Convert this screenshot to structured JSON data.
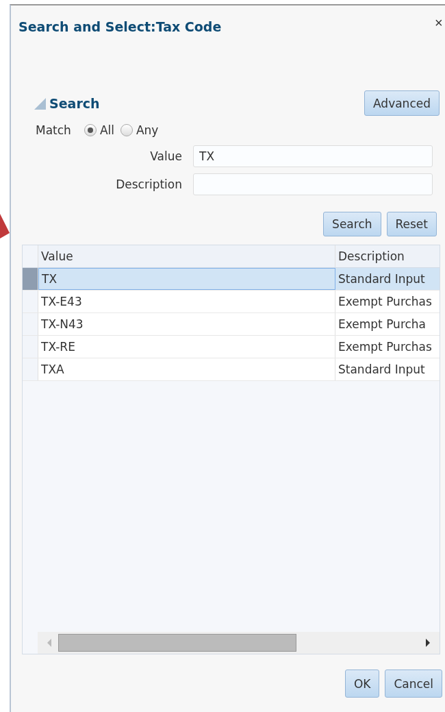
{
  "dialog": {
    "title": "Search and Select:Tax Code",
    "close": "×"
  },
  "search": {
    "heading": "Search",
    "advanced_button": "Advanced",
    "match_label": "Match",
    "match_options": [
      {
        "label": "All",
        "selected": true
      },
      {
        "label": "Any",
        "selected": false
      }
    ],
    "fields": [
      {
        "label": "Value",
        "value": "TX"
      },
      {
        "label": "Description"
      }
    ],
    "buttons": [
      "Search",
      "Reset"
    ]
  },
  "table": {
    "columns": [
      "Value",
      "Description"
    ],
    "rows": [
      {
        "cells": [
          "TX",
          "Standard Input"
        ],
        "selected": true
      },
      {
        "cells": [
          "TX-E43",
          "Exempt Purchas"
        ],
        "selected": false
      },
      {
        "cells": [
          "TX-N43",
          "Exempt Purcha"
        ],
        "selected": false
      },
      {
        "cells": [
          "TX-RE",
          "Exempt Purchas"
        ],
        "selected": false
      },
      {
        "cells": [
          "TXA",
          "Standard Input"
        ],
        "selected": false
      }
    ]
  },
  "buttons": [
    "OK",
    "Cancel"
  ]
}
